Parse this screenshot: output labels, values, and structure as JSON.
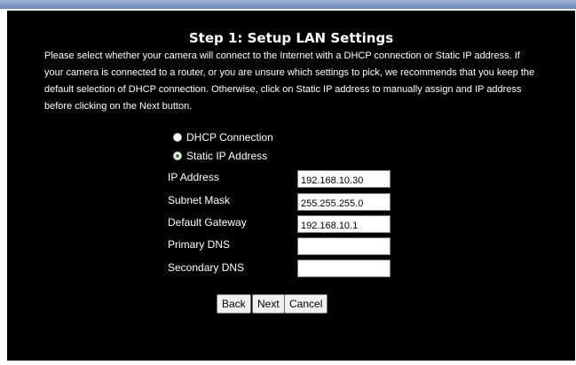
{
  "page": {
    "title": "Step 1: Setup LAN Settings",
    "intro": "Please select whether your camera will connect to the Internet with a DHCP connection or Static IP address. If your camera is connected to a router, or you are unsure which settings to pick, we recommends that you keep the default selection of DHCP connection. Otherwise, click on Static IP address to manually assign and IP address before clicking on the Next button."
  },
  "connection": {
    "options": [
      {
        "label": "DHCP Connection",
        "selected": false
      },
      {
        "label": "Static IP Address",
        "selected": true
      }
    ]
  },
  "fields": {
    "ip_address": {
      "label": "IP Address",
      "value": "192.168.10.30"
    },
    "subnet_mask": {
      "label": "Subnet Mask",
      "value": "255.255.255.0"
    },
    "default_gateway": {
      "label": "Default Gateway",
      "value": "192.168.10.1"
    },
    "primary_dns": {
      "label": "Primary DNS",
      "value": ""
    },
    "secondary_dns": {
      "label": "Secondary DNS",
      "value": ""
    }
  },
  "buttons": {
    "back": "Back",
    "next": "Next",
    "cancel": "Cancel"
  }
}
